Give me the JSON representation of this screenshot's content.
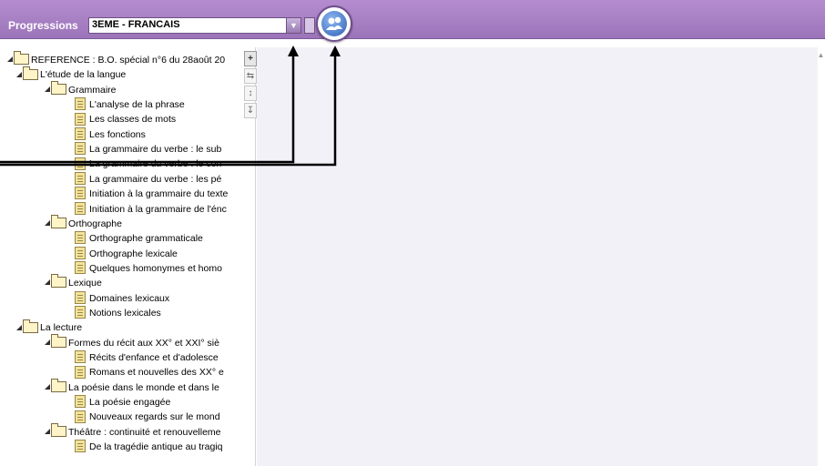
{
  "header": {
    "title": "Progressions",
    "combo_value": "3EME - FRANCAIS",
    "combo_arrow": "▼",
    "users_icon": "users-icon",
    "accent_color": "#a47fc2"
  },
  "tree": {
    "root": "REFERENCE : B.O. spécial n°6 du 28août 20",
    "items": [
      {
        "type": "folder",
        "level": 1,
        "label": "L'étude de la langue"
      },
      {
        "type": "folder",
        "level": 2,
        "label": "Grammaire"
      },
      {
        "type": "doc",
        "level": 3,
        "label": "L'analyse de la phrase"
      },
      {
        "type": "doc",
        "level": 3,
        "label": "Les classes de mots"
      },
      {
        "type": "doc",
        "level": 3,
        "label": "Les fonctions"
      },
      {
        "type": "doc",
        "level": 3,
        "label": "La grammaire du verbe : le sub"
      },
      {
        "type": "doc",
        "level": 3,
        "label": "La grammaire du verbe : le con"
      },
      {
        "type": "doc",
        "level": 3,
        "label": "La grammaire du verbe : les pé"
      },
      {
        "type": "doc",
        "level": 3,
        "label": "Initiation à la grammaire du texte"
      },
      {
        "type": "doc",
        "level": 3,
        "label": "Initiation à la grammaire de l'énc"
      },
      {
        "type": "folder",
        "level": 2,
        "label": "Orthographe"
      },
      {
        "type": "doc",
        "level": 3,
        "label": "Orthographe grammaticale"
      },
      {
        "type": "doc",
        "level": 3,
        "label": "Orthographe lexicale"
      },
      {
        "type": "doc",
        "level": 3,
        "label": "Quelques homonymes et homo"
      },
      {
        "type": "folder",
        "level": 2,
        "label": "Lexique"
      },
      {
        "type": "doc",
        "level": 3,
        "label": "Domaines lexicaux"
      },
      {
        "type": "doc",
        "level": 3,
        "label": "Notions lexicales"
      },
      {
        "type": "folder",
        "level": 1,
        "label": "La lecture"
      },
      {
        "type": "folder",
        "level": 2,
        "label": "Formes du récit aux XX° et XXI° siè"
      },
      {
        "type": "doc",
        "level": 3,
        "label": "Récits d'enfance et d'adolesce"
      },
      {
        "type": "doc",
        "level": 3,
        "label": "Romans et nouvelles des XX° e"
      },
      {
        "type": "folder",
        "level": 2,
        "label": "La poésie dans le monde et dans le"
      },
      {
        "type": "doc",
        "level": 3,
        "label": "La poésie engagée"
      },
      {
        "type": "doc",
        "level": 3,
        "label": "Nouveaux regards sur le mond"
      },
      {
        "type": "folder",
        "level": 2,
        "label": "Théâtre : continuité et renouvelleme"
      },
      {
        "type": "doc",
        "level": 3,
        "label": "De la tragédie antique au tragiq"
      }
    ]
  },
  "side_tools": [
    "+",
    "⇆",
    "↕",
    "↧"
  ]
}
